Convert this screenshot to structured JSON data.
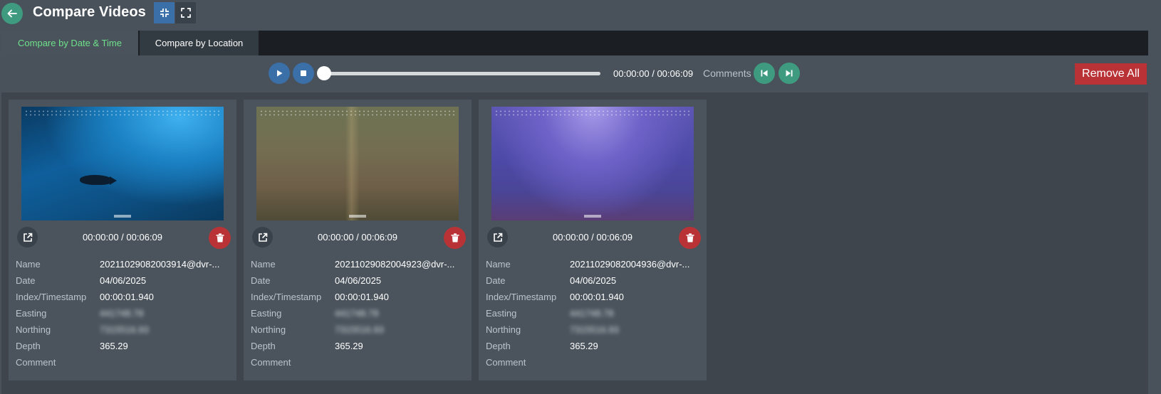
{
  "header": {
    "title": "Compare Videos"
  },
  "tabs": [
    {
      "label": "Compare by Date & Time",
      "active": true
    },
    {
      "label": "Compare by Location",
      "active": false
    }
  ],
  "player": {
    "time": "00:00:00 / 00:06:09",
    "comments_label": "Comments",
    "remove_all_label": "Remove All",
    "progress": 0
  },
  "colors": {
    "accent_teal": "#3f9b80",
    "accent_blue": "#3a6fa8",
    "danger": "#b93336",
    "active_tab_text": "#6fe08a"
  },
  "property_labels": {
    "name": "Name",
    "date": "Date",
    "index": "Index/Timestamp",
    "easting": "Easting",
    "northing": "Northing",
    "depth": "Depth",
    "comment": "Comment"
  },
  "videos": [
    {
      "time": "00:00:00 / 00:06:09",
      "name": "20211029082003914@dvr-...",
      "date": "04/06/2025",
      "index": "00:00:01.940",
      "easting": "441748.78",
      "northing": "7315516.93",
      "depth": "365.29",
      "comment": ""
    },
    {
      "time": "00:00:00 / 00:06:09",
      "name": "20211029082004923@dvr-...",
      "date": "04/06/2025",
      "index": "00:00:01.940",
      "easting": "441748.78",
      "northing": "7315516.93",
      "depth": "365.29",
      "comment": ""
    },
    {
      "time": "00:00:00 / 00:06:09",
      "name": "20211029082004936@dvr-...",
      "date": "04/06/2025",
      "index": "00:00:01.940",
      "easting": "441748.78",
      "northing": "7315516.93",
      "depth": "365.29",
      "comment": ""
    }
  ],
  "icons": {
    "back": "arrow-left-icon",
    "collapse": "collapse-icon",
    "expand": "fullscreen-icon",
    "play": "play-icon",
    "stop": "stop-icon",
    "prev": "skip-previous-icon",
    "next": "skip-next-icon",
    "external": "open-external-icon",
    "delete": "trash-icon"
  }
}
